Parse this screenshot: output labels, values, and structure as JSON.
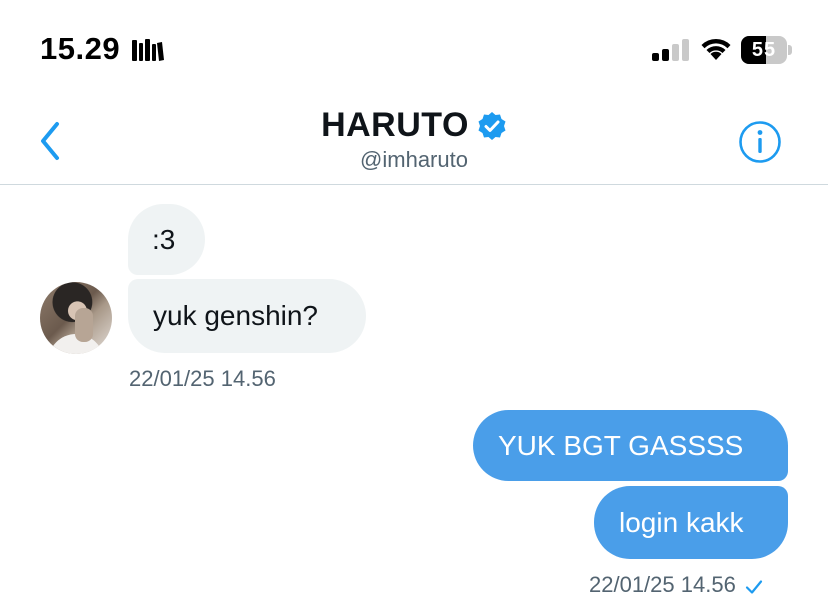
{
  "status_bar": {
    "time": "15.29",
    "battery_level": "55",
    "battery_fraction": 0.55,
    "library_icon": "books-icon",
    "signal_icon": "cellular-signal-icon",
    "wifi_icon": "wifi-icon"
  },
  "header": {
    "name": "HARUTO",
    "handle": "@imharuto",
    "back_icon": "chevron-left-icon",
    "verified_icon": "verified-badge-icon",
    "info_icon": "info-circle-icon"
  },
  "conversation": {
    "incoming": {
      "messages": [
        ":3",
        "yuk genshin?"
      ],
      "timestamp": "22/01/25 14.56",
      "avatar": "contact-avatar"
    },
    "outgoing": {
      "messages": [
        "YUK BGT GASSSS",
        "login kakk"
      ],
      "timestamp": "22/01/25 14.56",
      "status_icon": "checkmark-icon"
    }
  },
  "colors": {
    "accent": "#1d9bf0",
    "outgoing_bubble": "#4a9ee9",
    "incoming_bubble": "#eff3f4",
    "secondary_text": "#536471",
    "divider": "#cfd9de"
  }
}
